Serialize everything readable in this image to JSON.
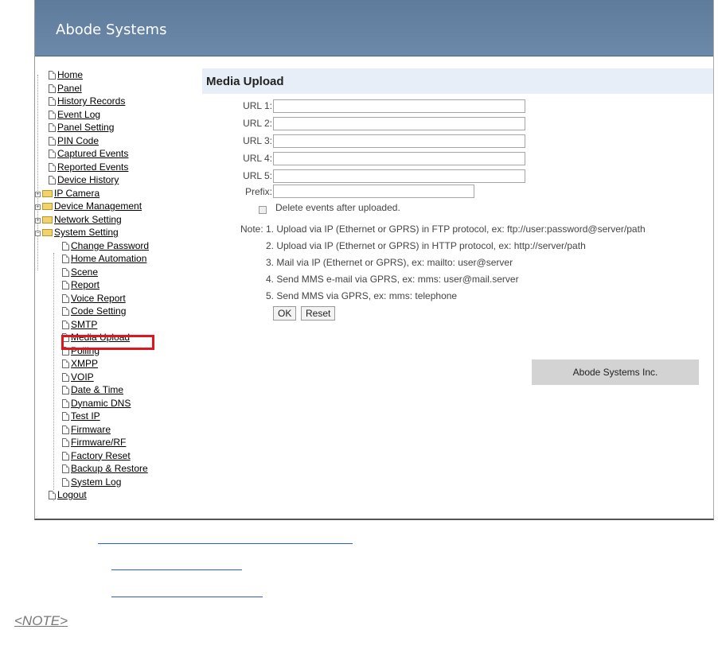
{
  "header": {
    "brand": "Abode Systems"
  },
  "nav": {
    "home": "Home",
    "panel": "Panel",
    "history_records": "History Records",
    "event_log": "Event Log",
    "panel_setting": "Panel Setting",
    "pin_code": "PIN Code",
    "captured_events": "Captured Events",
    "reported_events": "Reported Events",
    "device_history": "Device History",
    "ip_camera": "IP Camera",
    "device_management": "Device Management",
    "network_setting": "Network Setting",
    "system_setting": "System Setting",
    "system_children": [
      "Change Password",
      "Home Automation",
      "Scene",
      "Report",
      "Voice Report",
      "Code Setting",
      "SMTP",
      "Media Upload",
      "Polling",
      "XMPP",
      "VOIP",
      "Date & Time",
      "Dynamic DNS",
      "Test IP",
      "Firmware",
      "Firmware/RF",
      "Factory Reset",
      "Backup & Restore",
      "System Log"
    ],
    "logout": "Logout"
  },
  "main": {
    "title": "Media Upload",
    "url_labels": [
      "URL 1:",
      "URL 2:",
      "URL 3:",
      "URL 4:",
      "URL 5:"
    ],
    "url_values": [
      "",
      "",
      "",
      "",
      ""
    ],
    "prefix_label": "Prefix:",
    "prefix_value": "",
    "delete_label": "Delete events after uploaded.",
    "note_label": "Note:",
    "notes": [
      "1. Upload via IP (Ethernet or GPRS) in FTP protocol, ex: ftp://user:password@server/path",
      "2. Upload via IP (Ethernet or GPRS) in HTTP protocol, ex: http://server/path",
      "3. Mail via IP (Ethernet or GPRS), ex: mailto: user@server",
      "4. Send MMS e-mail via GPRS, ex: mms: user@mail.server",
      "5. Send MMS via GPRS, ex: mms: telephone"
    ],
    "ok_label": "OK",
    "reset_label": "Reset",
    "footer": "Abode Systems Inc."
  },
  "below": {
    "note_link": "<NOTE>"
  },
  "colors": {
    "header_bg": "#6a87a8",
    "selected_outline": "#e0161d",
    "title_bar_bg": "#e8eef7"
  }
}
